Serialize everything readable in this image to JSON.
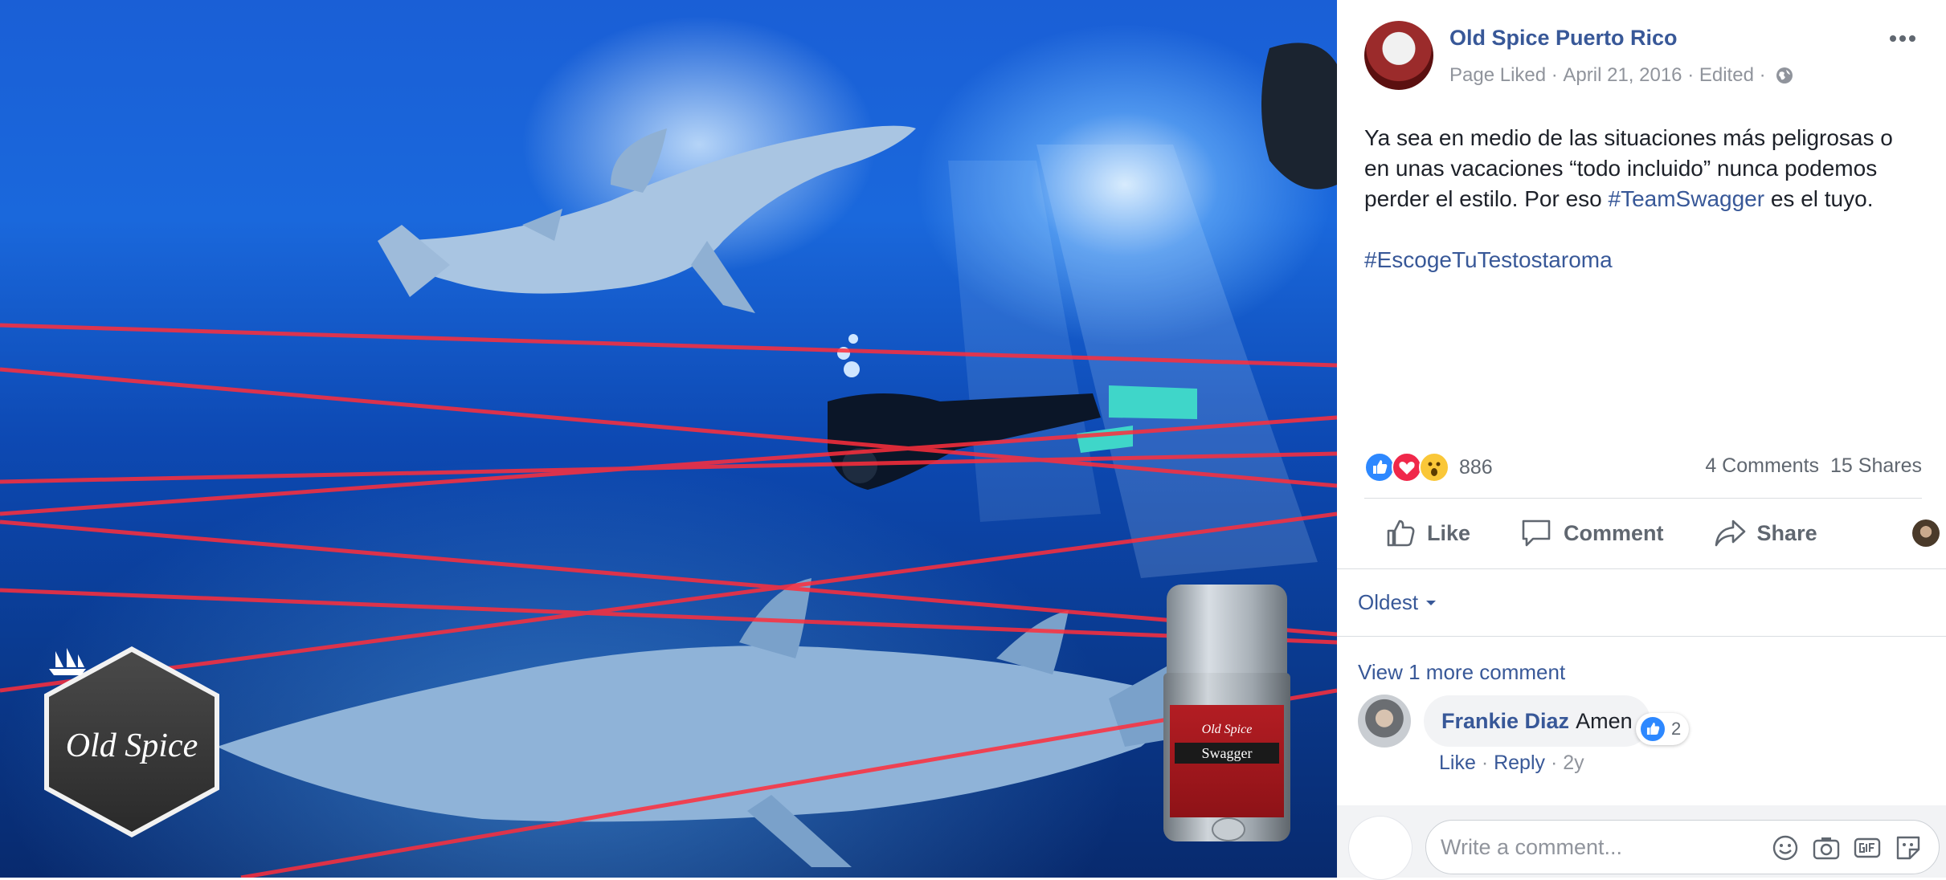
{
  "photo": {
    "logo_text": "Old Spice",
    "product_brand": "Old Spice",
    "product_name": "Swagger"
  },
  "post": {
    "page_name": "Old Spice Puerto Rico",
    "status": "Page Liked",
    "date": "April 21, 2016",
    "edited": "Edited",
    "separator": " · ",
    "text_part1": "Ya sea en medio de las situaciones más peligrosas o en unas vacaciones “todo incluido” nunca podemos perder el estilo. Por eso ",
    "hashtag1": "#TeamSwagger",
    "text_part2": " es el tuyo.",
    "hashtag2": "#EscogeTuTestostaroma"
  },
  "stats": {
    "reaction_count": "886",
    "comments": "4 Comments",
    "shares": "15 Shares",
    "reaction_icons": [
      "like-icon",
      "love-icon",
      "wow-icon"
    ]
  },
  "actions": {
    "like": "Like",
    "comment": "Comment",
    "share": "Share"
  },
  "comments": {
    "sort": "Oldest",
    "view_more": "View 1 more comment",
    "items": [
      {
        "author": "Frankie Diaz",
        "text": "Amen",
        "reactions": "2",
        "like": "Like",
        "reply": "Reply",
        "age": "2y"
      }
    ],
    "composer_placeholder": "Write a comment..."
  },
  "colors": {
    "link": "#385898",
    "like_blue": "#2d88ff",
    "love_red": "#f0284a",
    "wow_yellow": "#fac738"
  }
}
